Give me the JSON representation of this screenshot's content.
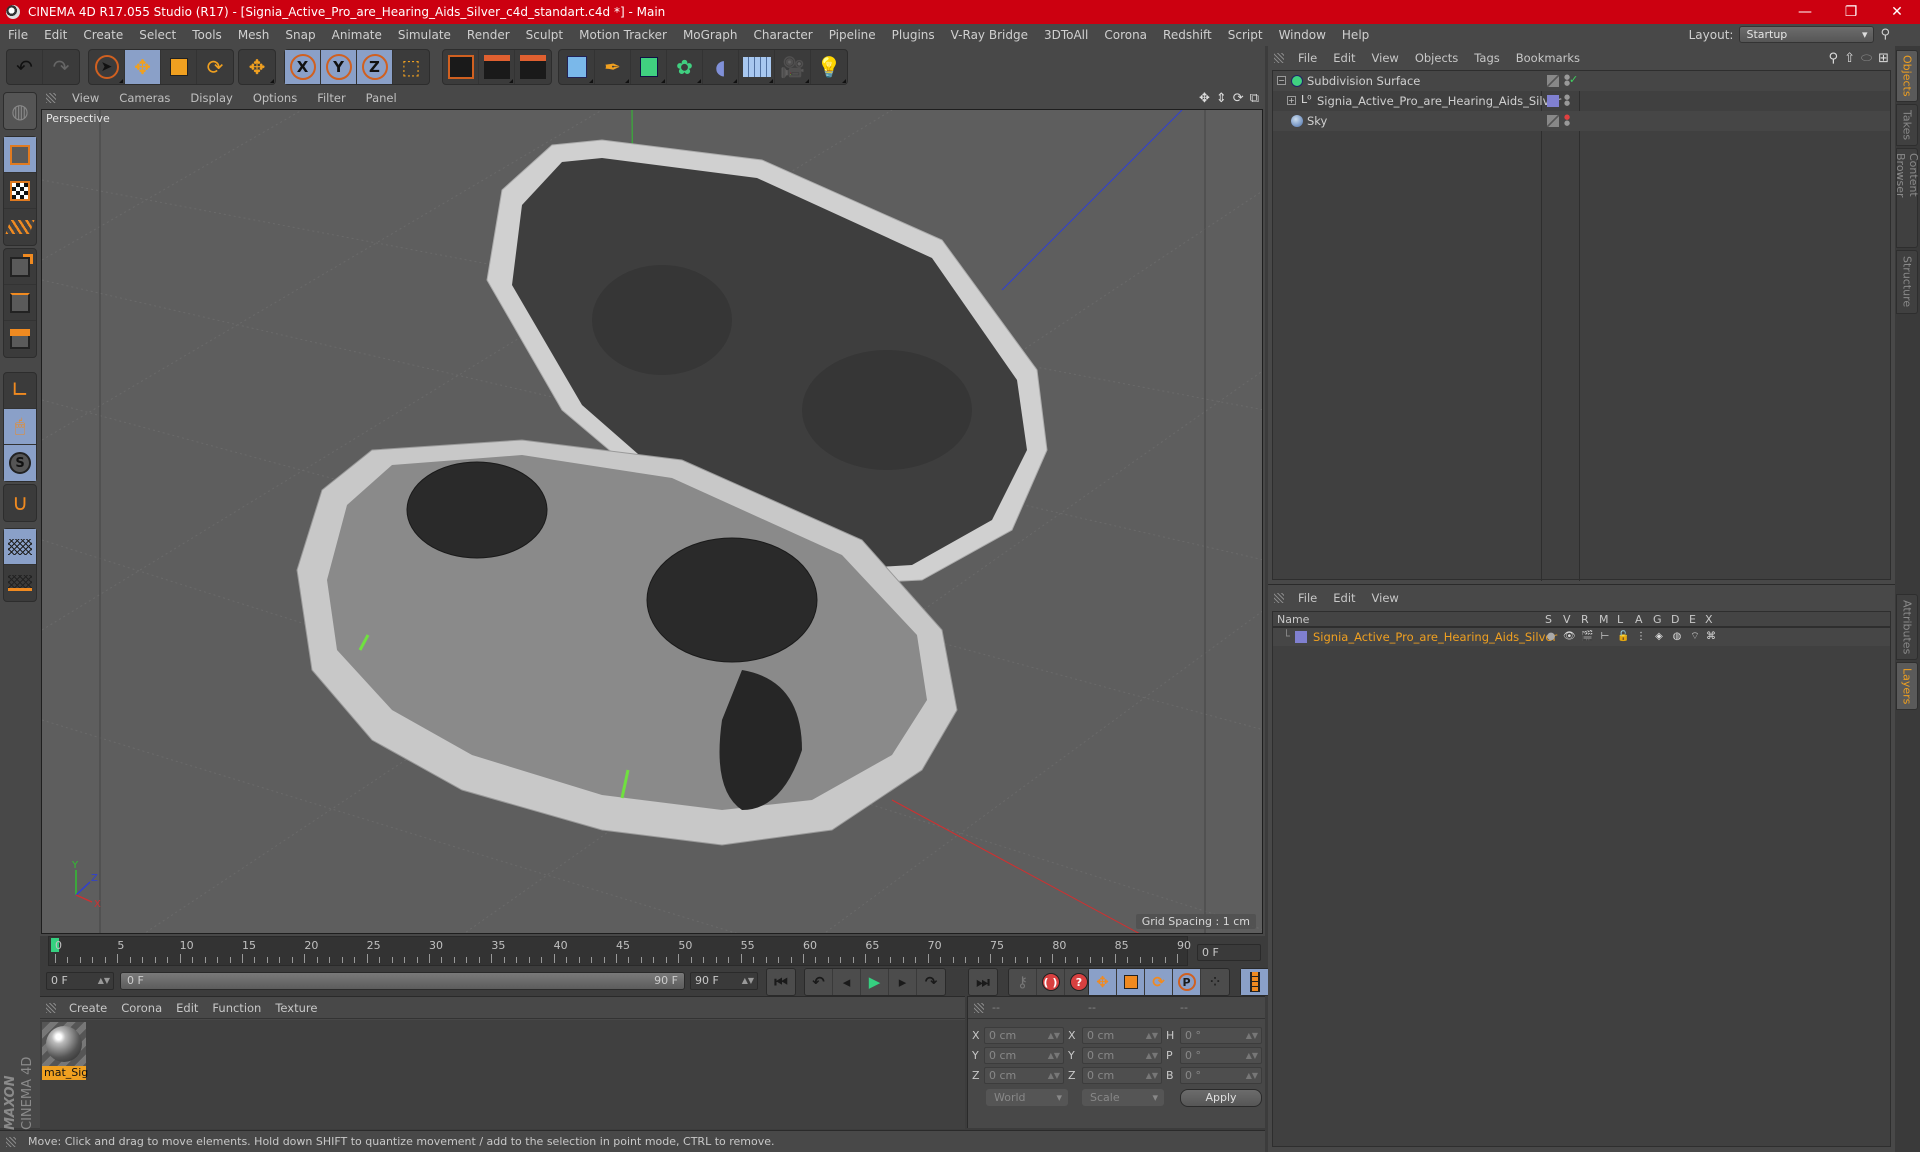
{
  "window": {
    "title": "CINEMA 4D R17.055 Studio (R17) - [Signia_Active_Pro_are_Hearing_Aids_Silver_c4d_standart.c4d *] - Main",
    "minimize": "—",
    "restore": "❐",
    "close": "✕"
  },
  "menubar": {
    "items": [
      "File",
      "Edit",
      "Create",
      "Select",
      "Tools",
      "Mesh",
      "Snap",
      "Animate",
      "Simulate",
      "Render",
      "Sculpt",
      "Motion Tracker",
      "MoGraph",
      "Character",
      "Pipeline",
      "Plugins",
      "V-Ray Bridge",
      "3DToAll",
      "Corona",
      "Redshift",
      "Script",
      "Window",
      "Help"
    ],
    "layout_label": "Layout:",
    "layout_value": "Startup"
  },
  "toolbar": {
    "undo": "undo-icon",
    "redo": "redo-icon",
    "tools": [
      "select-icon",
      "move-icon",
      "scale-icon",
      "rotate-icon",
      "live-move-icon"
    ],
    "axes": [
      "X",
      "Y",
      "Z"
    ],
    "coord_system": "world-coordinates-icon",
    "render": [
      "render-view-icon",
      "render-picture-viewer-icon",
      "render-settings-icon"
    ],
    "objects": [
      "cube-icon",
      "pen-spline-icon",
      "subdivision-icon",
      "cloner-icon",
      "deformer-icon",
      "floor-icon",
      "camera-icon",
      "light-icon"
    ]
  },
  "leftbar": {
    "items": [
      "make-editable-icon",
      "model-mode-icon",
      "texture-mode-icon",
      "workplane-icon",
      "points-mode-icon",
      "edges-mode-icon",
      "polygons-mode-icon",
      "axis-mode-icon",
      "tweak-mode-icon",
      "solo-icon",
      "snap-icon",
      "locked-workplane-icon",
      "planar-workplane-icon"
    ],
    "brand_top": "MAXON",
    "brand_bottom": "CINEMA 4D"
  },
  "viewport": {
    "menu": [
      "View",
      "Cameras",
      "Display",
      "Options",
      "Filter",
      "Panel"
    ],
    "label": "Perspective",
    "grid_spacing": "Grid Spacing : 1 cm",
    "axis_labels": {
      "x": "X",
      "y": "Y",
      "z": "Z"
    },
    "nav_icons": [
      "pan-icon",
      "dolly-icon",
      "orbit-icon",
      "maximize-view-icon"
    ],
    "colors": {
      "x_axis": "#d03030",
      "y_axis": "#30c030",
      "z_axis": "#3040d0",
      "background": "#5e5e5e"
    }
  },
  "timeline": {
    "ticks": [
      "0",
      "5",
      "10",
      "15",
      "20",
      "25",
      "30",
      "35",
      "40",
      "45",
      "50",
      "55",
      "60",
      "65",
      "70",
      "75",
      "80",
      "85",
      "90"
    ],
    "current_frame_field": "0 F",
    "start_field": "0 F",
    "range_start": "0 F",
    "range_end": "90 F",
    "end_field": "90 F",
    "playhead_frame": 0
  },
  "playback": {
    "buttons": [
      "go-to-start-icon",
      "previous-key-icon",
      "previous-frame-icon",
      "play-icon",
      "next-frame-icon",
      "next-key-icon",
      "go-to-end-icon"
    ],
    "record": [
      "keyframe-icon",
      "autokey-icon",
      "keyframe-selection-icon"
    ],
    "key_tracks": [
      "position-key-icon",
      "scale-key-icon",
      "rotation-key-icon",
      "parameter-key-icon",
      "pla-key-icon"
    ],
    "timeline_button": "timeline-icon"
  },
  "material_manager": {
    "menu": [
      "Create",
      "Corona",
      "Edit",
      "Function",
      "Texture"
    ],
    "materials": [
      {
        "name": "mat_Sig"
      }
    ]
  },
  "coordinates": {
    "headers": [
      "--",
      "--",
      "--"
    ],
    "rows": [
      {
        "a": "X",
        "pos": "0 cm",
        "b": "X",
        "size": "0 cm",
        "c": "H",
        "rot": "0 °"
      },
      {
        "a": "Y",
        "pos": "0 cm",
        "b": "Y",
        "size": "0 cm",
        "c": "P",
        "rot": "0 °"
      },
      {
        "a": "Z",
        "pos": "0 cm",
        "b": "Z",
        "size": "0 cm",
        "c": "B",
        "rot": "0 °"
      }
    ],
    "mode": "World",
    "size_mode": "Scale",
    "apply": "Apply"
  },
  "status": {
    "text": "Move: Click and drag to move elements. Hold down SHIFT to quantize movement / add to the selection in point mode, CTRL to remove."
  },
  "object_manager": {
    "menu": [
      "File",
      "Edit",
      "View",
      "Objects",
      "Tags",
      "Bookmarks"
    ],
    "objects": [
      {
        "name": "Subdivision Surface",
        "icon": "subdivision-surface-icon",
        "enabled": true
      },
      {
        "name": "Signia_Active_Pro_are_Hearing_Aids_Silver",
        "icon": "null-object-icon",
        "layer_color": "#8080d0"
      },
      {
        "name": "Sky",
        "icon": "sky-icon"
      }
    ]
  },
  "layer_manager": {
    "menu": [
      "File",
      "Edit",
      "View"
    ],
    "columns": [
      "Name",
      "S",
      "V",
      "R",
      "M",
      "L",
      "A",
      "G",
      "D",
      "E",
      "X"
    ],
    "layers": [
      {
        "name": "Signia_Active_Pro_are_Hearing_Aids_Silver",
        "color": "#8080d0",
        "name_color": "#f0a020"
      }
    ]
  },
  "side_tabs": {
    "top": [
      {
        "label": "Objects",
        "active": true
      },
      {
        "label": "Takes"
      },
      {
        "label": "Content Browser"
      },
      {
        "label": "Structure"
      }
    ],
    "bottom": [
      {
        "label": "Attributes"
      },
      {
        "label": "Layers",
        "active": true
      }
    ]
  }
}
